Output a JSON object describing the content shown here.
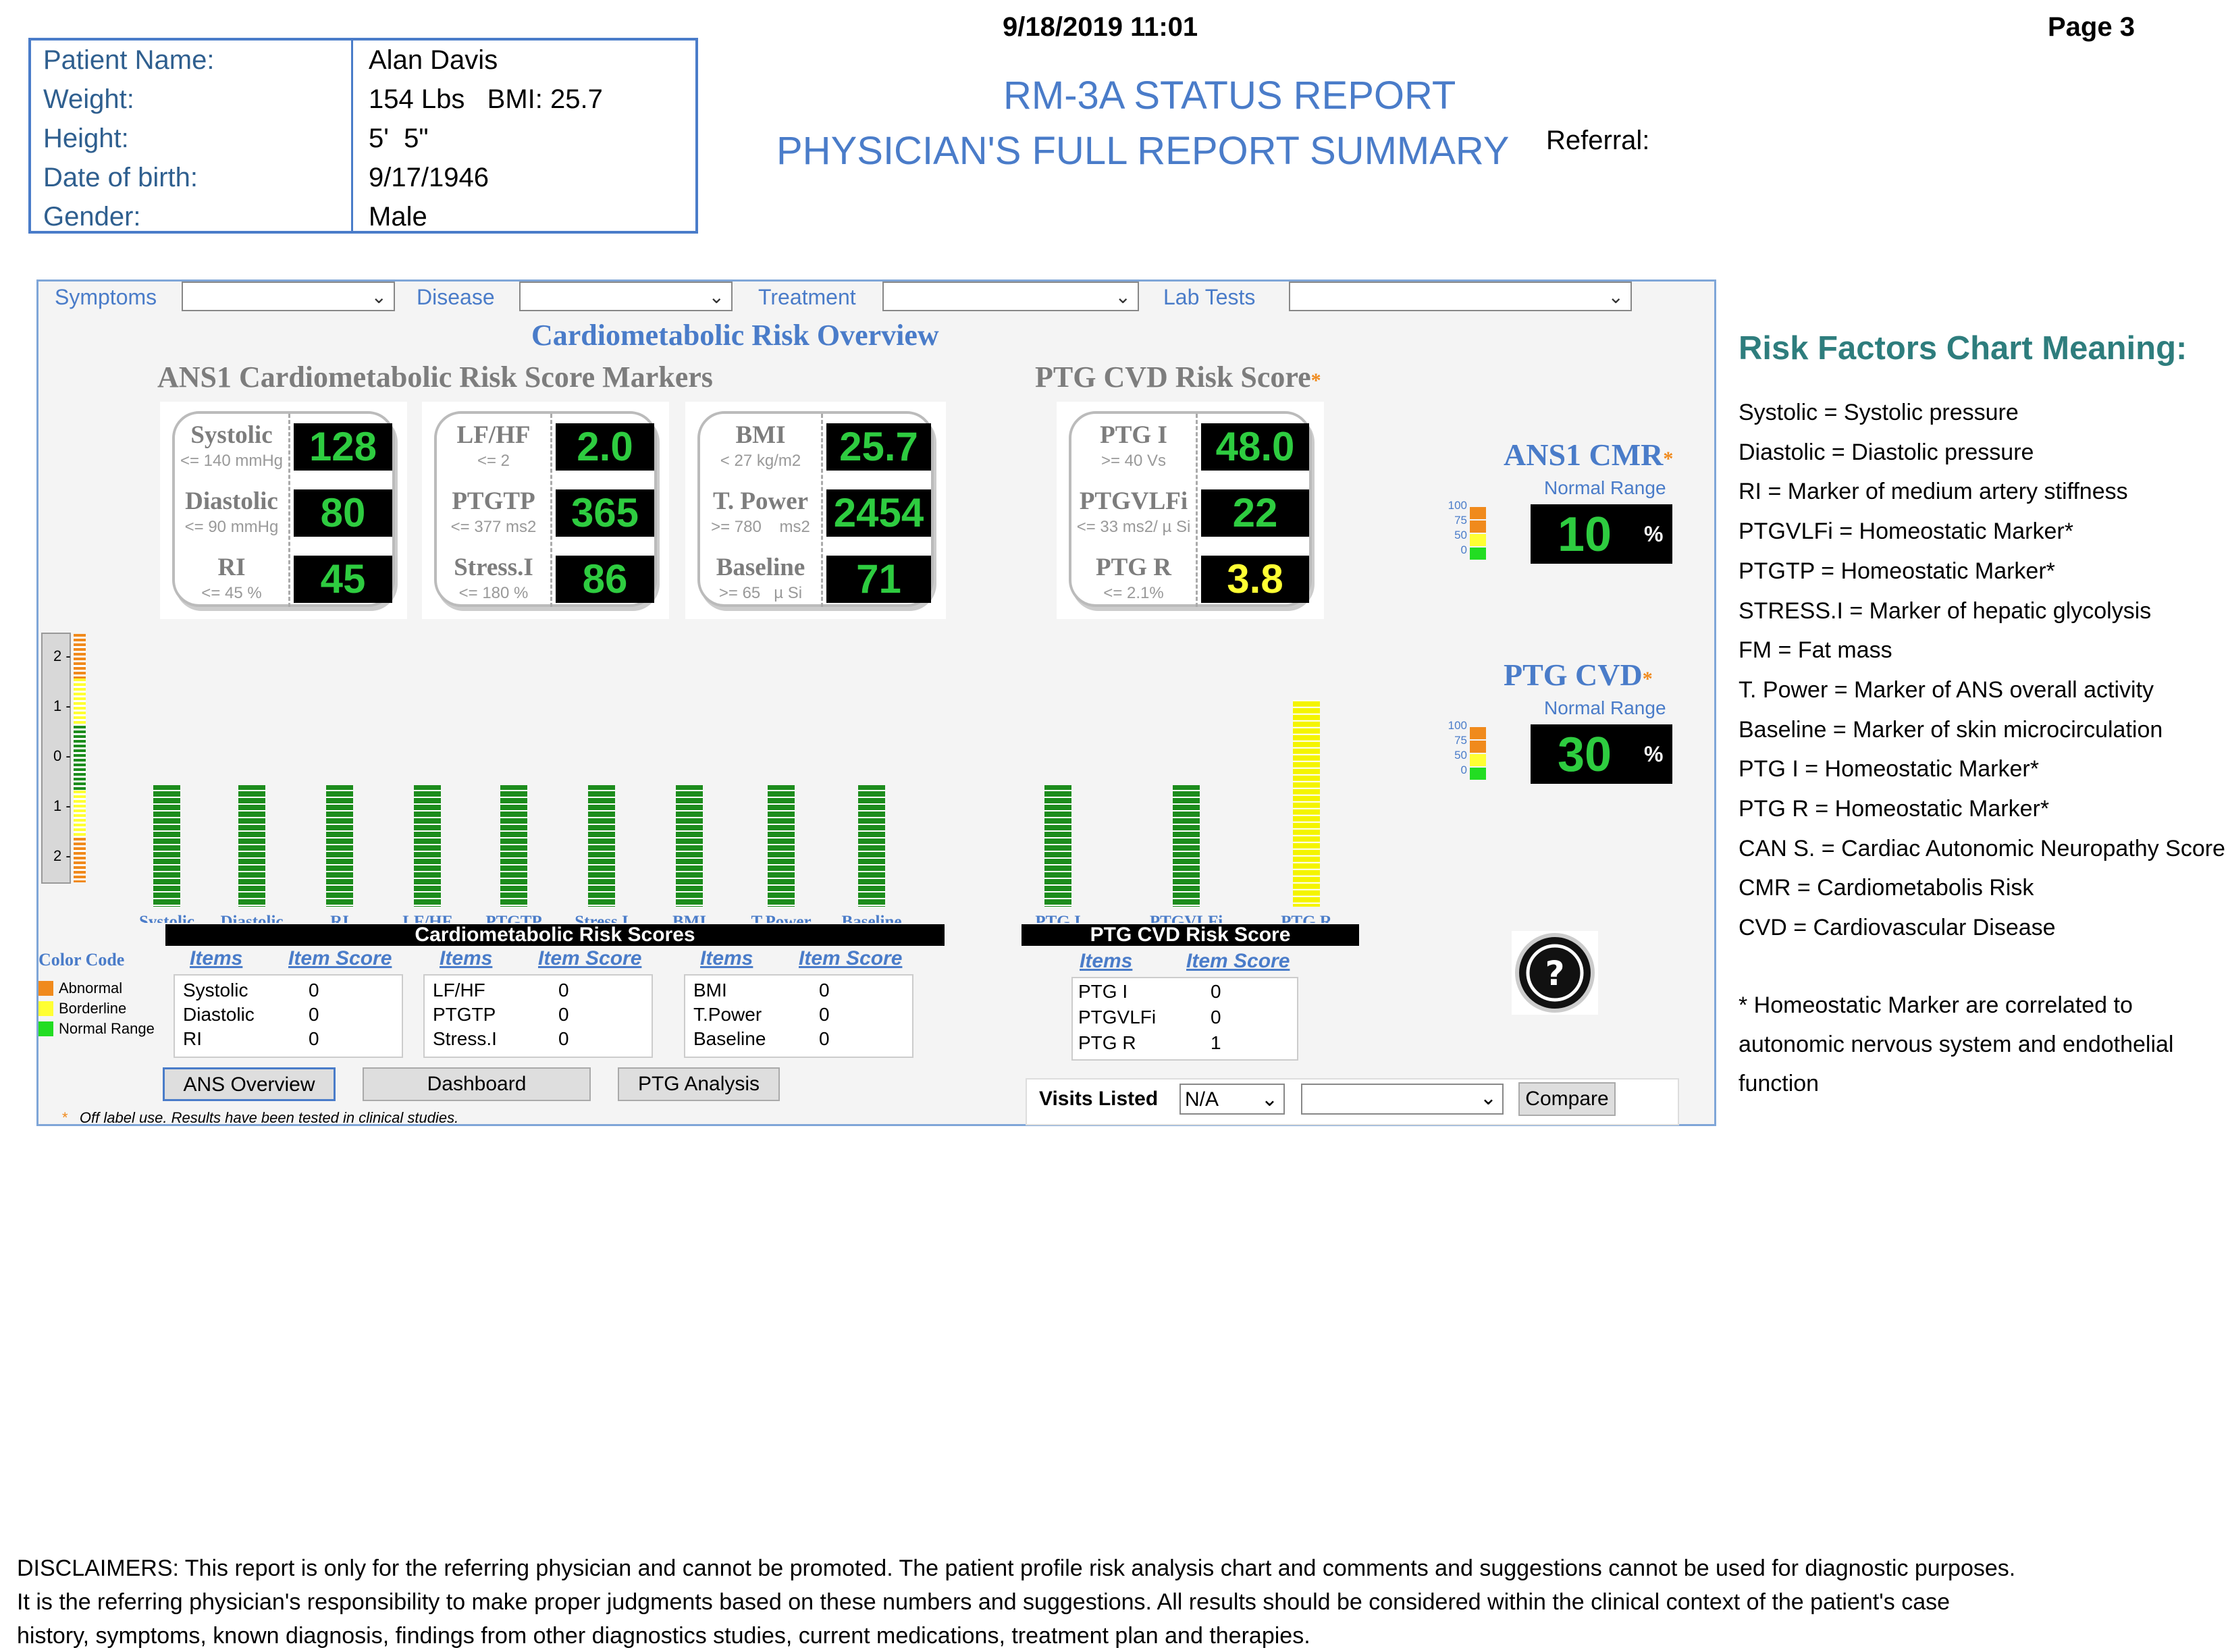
{
  "header": {
    "datetime": "9/18/2019  11:01",
    "page": "Page 3",
    "title1": "RM-3A STATUS REPORT",
    "title2": "PHYSICIAN'S FULL REPORT SUMMARY",
    "referral_label": "Referral:"
  },
  "patient": {
    "rows": [
      {
        "label": "Patient Name:",
        "value": "Alan Davis"
      },
      {
        "label": "Weight:",
        "value": "154 Lbs   BMI: 25.7"
      },
      {
        "label": "Height:",
        "value": "5'  5\""
      },
      {
        "label": "Date of birth:",
        "value": "9/17/1946"
      },
      {
        "label": "Gender:",
        "value": "Male"
      }
    ]
  },
  "filters": {
    "symptoms": "Symptoms",
    "disease": "Disease",
    "treatment": "Treatment",
    "lab_tests": "Lab Tests"
  },
  "overview_title": "Cardiometabolic Risk Overview",
  "ans_title": "ANS1 Cardiometabolic Risk Score Markers",
  "ptg_title": "PTG CVD Risk Score",
  "cards": [
    {
      "gauges": [
        {
          "name": "Systolic",
          "range": "<= 140 mmHg",
          "value": "128",
          "color": "#2ecc40"
        },
        {
          "name": "Diastolic",
          "range": "<= 90 mmHg",
          "value": "80",
          "color": "#2ecc40"
        },
        {
          "name": "RI",
          "range": "<= 45 %",
          "value": "45",
          "color": "#2ecc40"
        }
      ]
    },
    {
      "gauges": [
        {
          "name": "LF/HF",
          "range": "<= 2",
          "value": "2.0",
          "color": "#2ecc40"
        },
        {
          "name": "PTGTP",
          "range": "<= 377 ms2",
          "value": "365",
          "color": "#2ecc40"
        },
        {
          "name": "Stress.I",
          "range": "<= 180 %",
          "value": "86",
          "color": "#2ecc40"
        }
      ]
    },
    {
      "gauges": [
        {
          "name": "BMI",
          "range": "< 27 kg/m2",
          "value": "25.7",
          "color": "#2ecc40"
        },
        {
          "name": "T. Power",
          "range": ">= 780    ms2",
          "value": "2454",
          "color": "#2ecc40"
        },
        {
          "name": "Baseline",
          "range": ">= 65   µ Si",
          "value": "71",
          "color": "#2ecc40"
        }
      ]
    },
    {
      "gauges": [
        {
          "name": "PTG I",
          "range": ">= 40 Vs",
          "value": "48.0",
          "color": "#2ecc40"
        },
        {
          "name": "PTGVLFi",
          "range": "<= 33 ms2/ µ Si",
          "value": "22",
          "color": "#2ecc40"
        },
        {
          "name": "PTG R",
          "range": "<= 2.1%",
          "value": "3.8",
          "color": "#ffff33"
        }
      ]
    }
  ],
  "side_gauges": [
    {
      "title": "ANS1 CMR",
      "sub": "Normal Range",
      "value": "10",
      "unit": "%",
      "scale": [
        "100",
        "75",
        "50",
        "0"
      ]
    },
    {
      "title": "PTG CVD",
      "sub": "Normal Range",
      "value": "30",
      "unit": "%",
      "scale": [
        "100",
        "75",
        "50",
        "0"
      ]
    }
  ],
  "scale_ticks": [
    "2 -",
    "1 -",
    "0 -",
    "1 -",
    "2 -"
  ],
  "chart_data": {
    "type": "bar",
    "categories": [
      "Systolic",
      "Diastolic",
      "RI",
      "LF/HF",
      "PTGTP",
      "Stress.I",
      "BMI",
      "T.Power",
      "Baseline",
      "PTG I",
      "PTGVLFi",
      "PTG R"
    ],
    "values": [
      0,
      0,
      0,
      0,
      0,
      0,
      0,
      0,
      0,
      0,
      0,
      1
    ],
    "colors": [
      "#1c8c1c",
      "#1c8c1c",
      "#1c8c1c",
      "#1c8c1c",
      "#1c8c1c",
      "#1c8c1c",
      "#1c8c1c",
      "#1c8c1c",
      "#1c8c1c",
      "#1c8c1c",
      "#1c8c1c",
      "#f4f400"
    ],
    "ylim": [
      -2,
      2
    ]
  },
  "color_code": {
    "title": "Color Code",
    "items": [
      {
        "label": "Abnormal",
        "color": "#f08a1c"
      },
      {
        "label": "Borderline",
        "color": "#ffff33"
      },
      {
        "label": "Normal Range",
        "color": "#22dd22"
      }
    ]
  },
  "cardio_scores": {
    "title": "Cardiometabolic Risk Scores",
    "col_items": "Items",
    "col_score": "Item Score",
    "groups": [
      [
        {
          "item": "Systolic",
          "score": "0"
        },
        {
          "item": "Diastolic",
          "score": "0"
        },
        {
          "item": "RI",
          "score": "0"
        }
      ],
      [
        {
          "item": "LF/HF",
          "score": "0"
        },
        {
          "item": "PTGTP",
          "score": "0"
        },
        {
          "item": "Stress.I",
          "score": "0"
        }
      ],
      [
        {
          "item": "BMI",
          "score": "0"
        },
        {
          "item": "T.Power",
          "score": "0"
        },
        {
          "item": "Baseline",
          "score": "0"
        }
      ]
    ]
  },
  "ptg_scores": {
    "title": "PTG CVD Risk Score",
    "col_items": "Items",
    "col_score": "Item Score",
    "rows": [
      {
        "item": "PTG I",
        "score": "0"
      },
      {
        "item": "PTGVLFi",
        "score": "0"
      },
      {
        "item": "PTG R",
        "score": "1"
      }
    ]
  },
  "buttons": {
    "ans_overview": "ANS Overview",
    "dashboard": "Dashboard",
    "ptg_analysis": "PTG Analysis",
    "visits_listed": "Visits Listed",
    "visits_value": "N/A",
    "compare": "Compare"
  },
  "footnote": "Off label use. Results have been tested in clinical studies.",
  "legend": {
    "title": "Risk Factors Chart Meaning:",
    "lines": [
      "Systolic = Systolic pressure",
      "Diastolic = Diastolic pressure",
      "RI = Marker of medium artery stiffness",
      "PTGVLFi = Homeostatic Marker*",
      "PTGTP = Homeostatic Marker*",
      "STRESS.I = Marker of hepatic glycolysis",
      "FM = Fat mass",
      "T. Power = Marker of ANS overall activity",
      "Baseline = Marker of skin microcirculation",
      "PTG I = Homeostatic Marker*",
      "PTG R = Homeostatic Marker*",
      "CAN S. = Cardiac Autonomic Neuropathy Score",
      "CMR = Cardiometabolis Risk",
      "CVD = Cardiovascular Disease"
    ],
    "note": [
      "* Homeostatic Marker are correlated to",
      "autonomic nervous system and endothelial",
      "function"
    ]
  },
  "disclaimer": [
    "DISCLAIMERS: This report is only for the referring physician and cannot be promoted. The patient profile risk analysis chart and comments and suggestions cannot be used for diagnostic purposes.",
    "It is the referring physician's responsibility to make proper judgments based on these numbers and suggestions. All results should be considered within the clinical context of the patient's case",
    "history, symptoms, known diagnosis, findings from other diagnostics studies, current medications, treatment plan and therapies."
  ]
}
